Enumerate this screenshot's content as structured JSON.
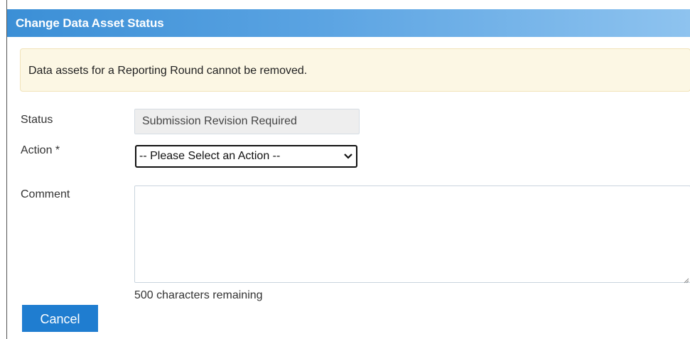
{
  "dialog": {
    "title": "Change Data Asset Status",
    "warning": "Data assets for a Reporting Round cannot be removed."
  },
  "form": {
    "status_label": "Status",
    "status_value": "Submission Revision Required",
    "action_label": "Action *",
    "action_selected": "-- Please Select an Action --",
    "comment_label": "Comment",
    "comment_value": "",
    "chars_remaining": "500 characters remaining"
  },
  "buttons": {
    "cancel_label": "Cancel"
  },
  "colors": {
    "header_start": "#3b8fd6",
    "header_end": "#8ec3ef",
    "warning_bg": "#fcf7e4",
    "button_bg": "#1f7dd0"
  }
}
